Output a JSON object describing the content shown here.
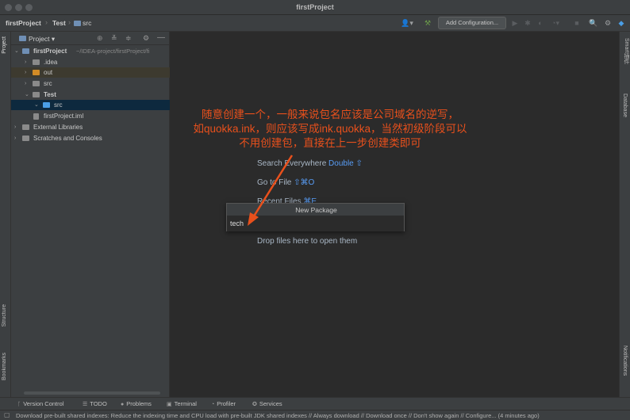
{
  "window": {
    "title": "firstProject"
  },
  "navbar": {
    "crumbs": [
      "firstProject",
      "Test",
      "src"
    ],
    "add_config": "Add Configuration..."
  },
  "left_strip": {
    "project": "Project",
    "structure": "Structure",
    "bookmarks": "Bookmarks"
  },
  "right_strip": {
    "smart": "Smart插件",
    "database": "Database",
    "notifications": "Notifications"
  },
  "project_panel": {
    "title": "Project",
    "tree": [
      {
        "label": "firstProject",
        "hint": "~/IDEA-project/firstProject/fi",
        "icon": "module-folder-icon",
        "color": "#6f8fb5"
      },
      {
        "label": ".idea",
        "icon": "folder-icon",
        "color": "#8a8a8a"
      },
      {
        "label": "out",
        "icon": "folder-icon",
        "color": "#d28b26"
      },
      {
        "label": "src",
        "icon": "folder-icon",
        "color": "#8a8a8a"
      },
      {
        "label": "Test",
        "icon": "module-folder-icon",
        "color": "#8a8a8a"
      },
      {
        "label": "src",
        "icon": "source-folder-icon",
        "color": "#4a9ee6"
      },
      {
        "label": "firstProject.iml",
        "icon": "iml-file-icon",
        "color": "#8a8a8a"
      },
      {
        "label": "External Libraries",
        "icon": "libraries-icon",
        "color": "#8a8a8a"
      },
      {
        "label": "Scratches and Consoles",
        "icon": "scratches-icon",
        "color": "#8a8a8a"
      }
    ]
  },
  "editor": {
    "hints": [
      {
        "text": "Search Everywhere",
        "key": "Double ⇧"
      },
      {
        "text": "Go to File",
        "key": "⇧⌘O"
      },
      {
        "text": "Recent Files",
        "key": "⌘E"
      },
      {
        "text": "Drop files here to open them",
        "key": ""
      }
    ]
  },
  "dialog": {
    "title": "New Package",
    "value": "tech"
  },
  "annotation": {
    "lines": [
      "随意创建一个，一般来说包名应该是公司域名的逆写，",
      "如quokka.ink，则应该写成ink.quokka，当然初级阶段可以",
      "不用创建包，直接在上一步创建类即可"
    ],
    "color": "#e8501c"
  },
  "bottom_tabs": [
    "Version Control",
    "TODO",
    "Problems",
    "Terminal",
    "Profiler",
    "Services"
  ],
  "status": {
    "text": "Download pre-built shared indexes: Reduce the indexing time and CPU load with pre-built JDK shared indexes // Always download // Download once // Don't show again // Configure... (4 minutes ago)"
  }
}
